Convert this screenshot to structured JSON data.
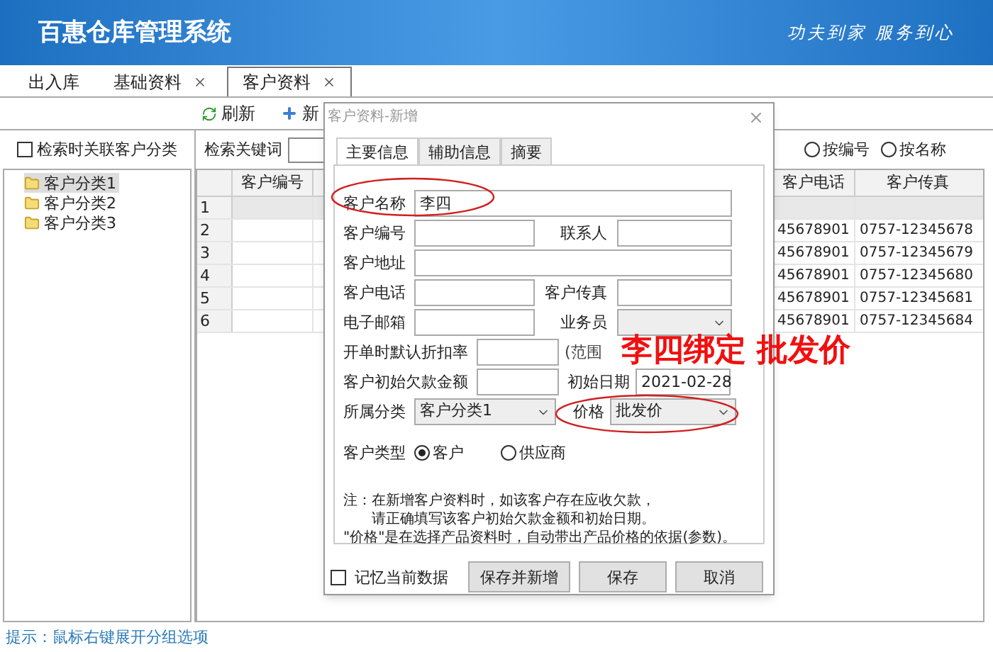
{
  "header": {
    "title": "百惠仓库管理系统",
    "slogan": "功夫到家 服务到心"
  },
  "tabs": [
    {
      "label": "出入库",
      "selected": false,
      "closable": false
    },
    {
      "label": "基础资料",
      "selected": false,
      "closable": true
    },
    {
      "label": "客户资料",
      "selected": true,
      "closable": true
    }
  ],
  "toolbar": [
    {
      "kind": "refresh",
      "label": "刷新"
    },
    {
      "kind": "add",
      "label": "新"
    }
  ],
  "filter": {
    "link_checkbox": {
      "label": "检索时关联客户分类",
      "checked": false
    },
    "search_label": "检索关键词",
    "radios": [
      {
        "label": "按编号",
        "selected": false
      },
      {
        "label": "按名称",
        "selected": false
      }
    ]
  },
  "tree": [
    {
      "label": "客户分类1",
      "selected": true
    },
    {
      "label": "客户分类2",
      "selected": false
    },
    {
      "label": "客户分类3",
      "selected": false
    }
  ],
  "grid": {
    "columns": [
      "客户编号",
      "客户电话",
      "客户传真"
    ],
    "rows": [
      {
        "number": "1",
        "selected": true
      },
      {
        "number": "2",
        "selected": false,
        "phone": "45678901",
        "fax": "0757-12345678"
      },
      {
        "number": "3",
        "selected": false,
        "phone": "45678901",
        "fax": "0757-12345679"
      },
      {
        "number": "4",
        "selected": false,
        "phone": "45678901",
        "fax": "0757-12345680"
      },
      {
        "number": "5",
        "selected": false,
        "phone": "45678901",
        "fax": "0757-12345681"
      },
      {
        "number": "6",
        "selected": false,
        "phone": "45678901",
        "fax": "0757-12345684"
      }
    ]
  },
  "status_bar": "提示：鼠标右键展开分组选项",
  "dialog": {
    "title": "客户资料-新增",
    "tabs": [
      {
        "label": "主要信息",
        "selected": true
      },
      {
        "label": "辅助信息",
        "selected": false
      },
      {
        "label": "摘要",
        "selected": false
      }
    ],
    "name": {
      "label": "客户名称",
      "value": "李四"
    },
    "code": {
      "label": "客户编号"
    },
    "contact": {
      "label": "联系人"
    },
    "address": {
      "label": "客户地址"
    },
    "phone": {
      "label": "客户电话"
    },
    "fax": {
      "label": "客户传真"
    },
    "email": {
      "label": "电子邮箱"
    },
    "salesman": {
      "label": "业务员"
    },
    "discount": {
      "label": "开单时默认折扣率",
      "hint": "(范围"
    },
    "debt": {
      "label": "客户初始欠款金额"
    },
    "date": {
      "label": "初始日期",
      "value": "2021-02-28"
    },
    "category": {
      "label": "所属分类",
      "value": "客户分类1"
    },
    "price": {
      "label": "价格",
      "value": "批发价"
    },
    "type": {
      "label": "客户类型",
      "options": [
        {
          "label": "客户",
          "selected": true
        },
        {
          "label": "供应商",
          "selected": false
        }
      ]
    },
    "note": [
      "注：在新增客户资料时，如该客户存在应收欠款，",
      "请正确填写该客户初始欠款金额和初始日期。",
      "\"价格\"是在选择产品资料时，自动带出产品价格的依据(参数)。"
    ],
    "remember": {
      "label": "记忆当前数据",
      "checked": false
    },
    "buttons": [
      "保存并新增",
      "保存",
      "取消"
    ]
  },
  "annotation": "李四绑定 批发价"
}
